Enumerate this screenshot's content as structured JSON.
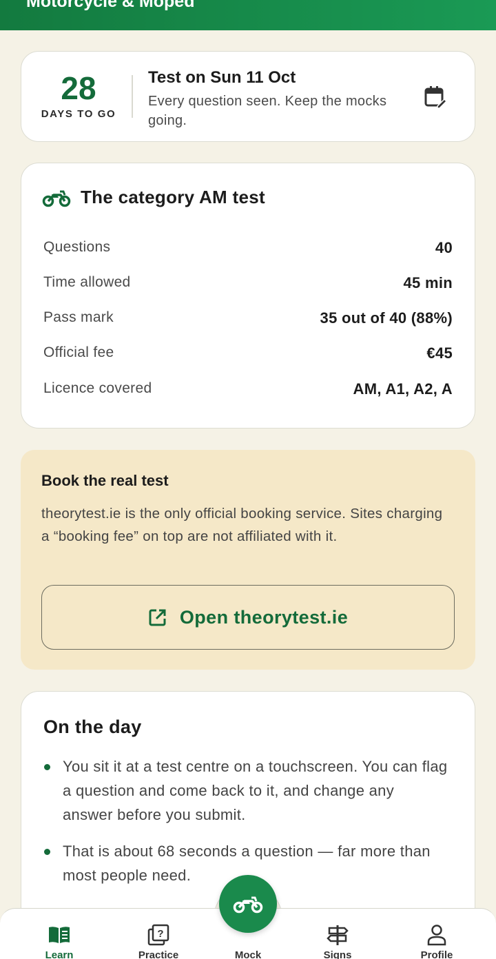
{
  "header": {
    "title": "Motorcycle & Moped"
  },
  "countdown": {
    "days": "28",
    "days_label": "DAYS TO GO",
    "test_title": "Test on Sun 11 Oct",
    "subtitle": "Every question seen. Keep the mocks going.",
    "calendar_icon": "calendar-edit-icon"
  },
  "facts": {
    "icon": "motorcycle-icon",
    "title": "The category AM test",
    "rows": [
      {
        "label": "Questions",
        "value": "40"
      },
      {
        "label": "Time allowed",
        "value": "45 min"
      },
      {
        "label": "Pass mark",
        "value": "35 out of 40 (88%)"
      },
      {
        "label": "Official fee",
        "value": "€45"
      },
      {
        "label": "Licence covered",
        "value": "AM, A1, A2, A"
      }
    ]
  },
  "booking": {
    "title": "Book the real test",
    "body": "theorytest.ie is the only official booking service. Sites charging a “booking fee” on top are not affiliated with it.",
    "button_label": "Open theorytest.ie",
    "button_icon": "external-link-icon"
  },
  "on_the_day": {
    "title": "On the day",
    "items": [
      "You sit it at a test centre on a touchscreen. You can flag a question and come back to it, and change any answer before you submit.",
      "That is about 68 seconds a question — far more than most people need."
    ]
  },
  "nav": {
    "items": [
      {
        "label": "Learn",
        "icon": "book-icon",
        "active": true
      },
      {
        "label": "Practice",
        "icon": "question-icon"
      },
      {
        "label": "Mock",
        "icon": "motorcycle-icon"
      },
      {
        "label": "Signs",
        "icon": "signpost-icon"
      },
      {
        "label": "Profile",
        "icon": "person-icon"
      }
    ]
  },
  "colors": {
    "brand": "#146b3a",
    "header_gradient_start": "#137a3f",
    "header_gradient_end": "#1a9a55",
    "background": "#f5f2e6",
    "booking_bg": "#f5e8c8",
    "fab": "#1a8a4c"
  }
}
